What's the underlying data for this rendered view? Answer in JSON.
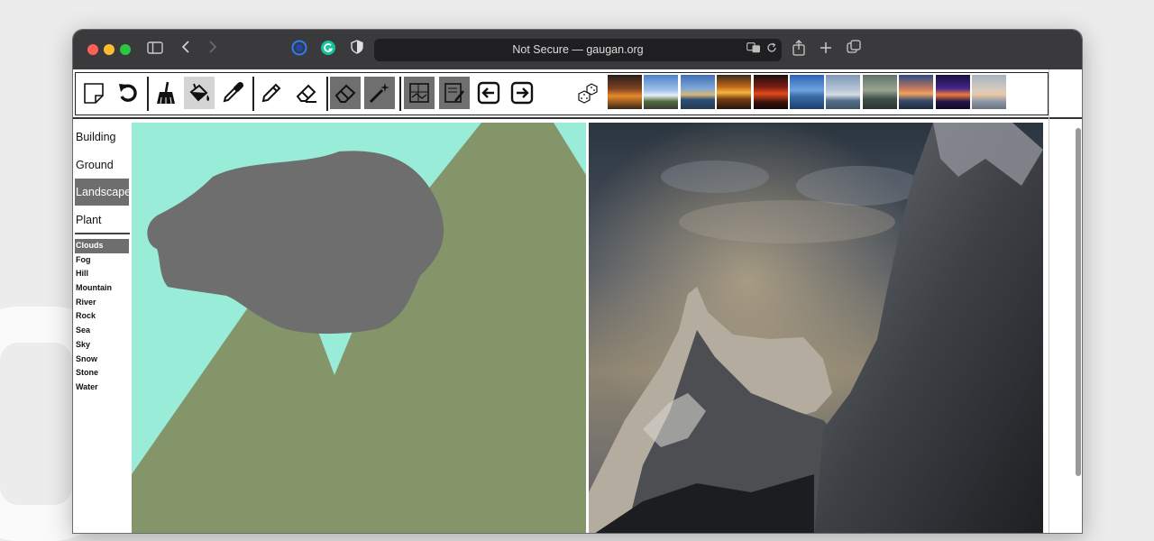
{
  "browser": {
    "url_text": "Not Secure — gaugan.org"
  },
  "categories": [
    {
      "label": "Building",
      "selected": false
    },
    {
      "label": "Ground",
      "selected": false
    },
    {
      "label": "Landscape",
      "selected": true
    },
    {
      "label": "Plant",
      "selected": false
    }
  ],
  "subcategories": [
    {
      "label": "Clouds",
      "selected": true
    },
    {
      "label": "Fog",
      "selected": false
    },
    {
      "label": "Hill",
      "selected": false
    },
    {
      "label": "Mountain",
      "selected": false
    },
    {
      "label": "River",
      "selected": false
    },
    {
      "label": "Rock",
      "selected": false
    },
    {
      "label": "Sea",
      "selected": false
    },
    {
      "label": "Sky",
      "selected": false
    },
    {
      "label": "Snow",
      "selected": false
    },
    {
      "label": "Stone",
      "selected": false
    },
    {
      "label": "Water",
      "selected": false
    }
  ],
  "tools": [
    "new-canvas-icon",
    "undo-icon",
    "broom-icon",
    "paint-bucket-icon",
    "eyedropper-icon",
    "pencil-icon",
    "eraser-icon",
    "eraser-large-icon",
    "magic-wand-icon",
    "segmentation-map-icon",
    "sketch-map-icon",
    "arrow-left-icon",
    "arrow-right-icon",
    "dice-icon"
  ],
  "colors": {
    "sky_label": "#98ecd8",
    "mountain_label": "#84956a",
    "clouds_label": "#6e6e6e",
    "selected_item": "#6e6e6e"
  },
  "style_thumbnail_count": 11
}
